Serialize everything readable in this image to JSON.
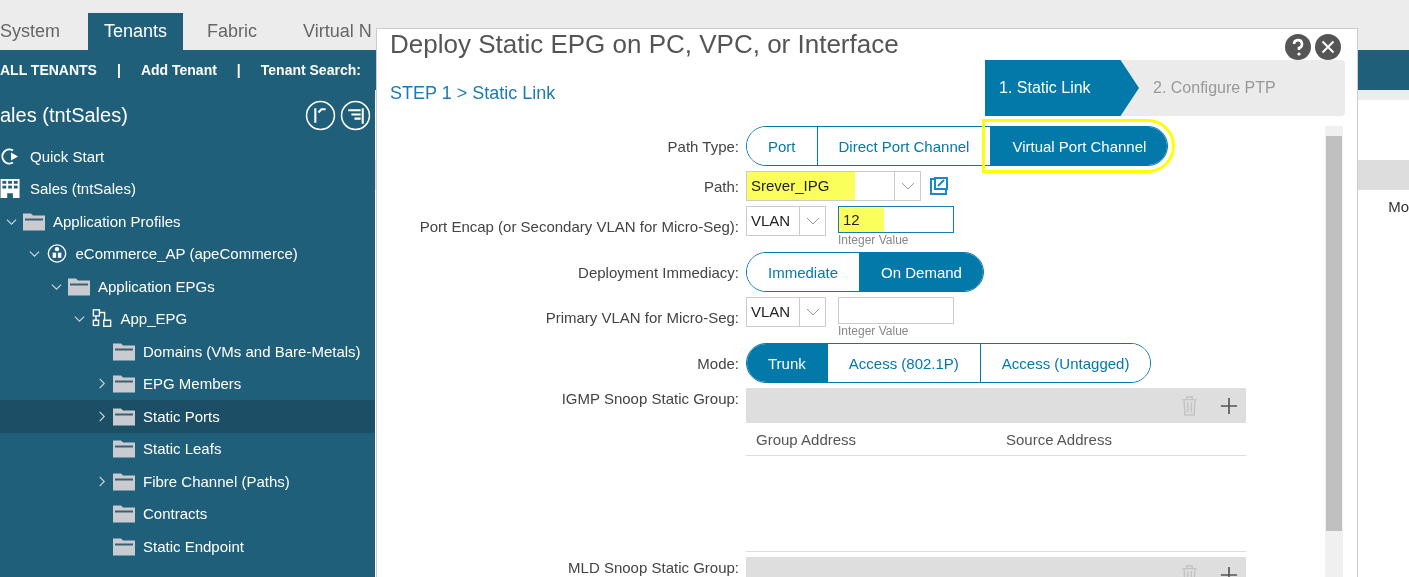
{
  "top_tabs": [
    {
      "label": "System",
      "selected": false
    },
    {
      "label": "Tenants",
      "selected": true
    },
    {
      "label": "Fabric",
      "selected": false
    },
    {
      "label": "Virtual N",
      "selected": false
    }
  ],
  "tenant_bar": {
    "links": [
      "ALL TENANTS",
      "Add Tenant"
    ],
    "separators": [
      "|",
      "|"
    ],
    "search_label": "Tenant Search:"
  },
  "sidebar": {
    "title": "ales (tntSales)",
    "items": [
      {
        "label": "Quick Start",
        "kind": "quickstart",
        "selected": false
      },
      {
        "label": "Sales (tntSales)",
        "kind": "tenant",
        "selected": false
      },
      {
        "label": "Application Profiles",
        "kind": "folder",
        "selected": false,
        "expanded": true,
        "children": [
          {
            "label": "eCommerce_AP (apeCommerce)",
            "kind": "profile",
            "selected": false,
            "expanded": true,
            "children": [
              {
                "label": "Application EPGs",
                "kind": "folder",
                "selected": false,
                "expanded": true,
                "children": [
                  {
                    "label": "App_EPG",
                    "kind": "epg",
                    "selected": false,
                    "expanded": true,
                    "children": [
                      {
                        "label": "Domains (VMs and Bare-Metals)",
                        "kind": "folder",
                        "selected": false
                      },
                      {
                        "label": "EPG Members",
                        "kind": "folder",
                        "selected": false,
                        "expanded": false
                      },
                      {
                        "label": "Static Ports",
                        "kind": "folder",
                        "selected": true,
                        "expanded": false
                      },
                      {
                        "label": "Static Leafs",
                        "kind": "folder",
                        "selected": false
                      },
                      {
                        "label": "Fibre Channel (Paths)",
                        "kind": "folder",
                        "selected": false,
                        "expanded": false
                      },
                      {
                        "label": "Contracts",
                        "kind": "folder",
                        "selected": false
                      },
                      {
                        "label": "Static Endpoint",
                        "kind": "folder",
                        "selected": false
                      }
                    ]
                  }
                ]
              }
            ]
          }
        ]
      }
    ]
  },
  "background_column_label": "Mo",
  "dialog": {
    "title": "Deploy Static EPG on PC, VPC, or Interface",
    "step": "STEP 1 > Static Link",
    "wizard": [
      {
        "label": "1. Static Link",
        "selected": true
      },
      {
        "label": "2. Configure PTP",
        "selected": false
      }
    ],
    "rows": [
      {
        "kind": "segmented",
        "label": "Path Type:",
        "options": [
          {
            "label": "Port",
            "selected": false,
            "highlighted": false
          },
          {
            "label": "Direct Port Channel",
            "selected": false,
            "highlighted": false
          },
          {
            "label": "Virtual Port Channel",
            "selected": true,
            "highlighted": true
          }
        ]
      },
      {
        "kind": "select",
        "label": "Path:",
        "value": "Srever_IPG",
        "highlighted": true
      },
      {
        "kind": "select-input",
        "label": "Port Encap (or Secondary VLAN for Micro-Seg):",
        "select_value": "VLAN",
        "value": "12",
        "hint": "Integer Value",
        "focused": true,
        "highlighted": true
      },
      {
        "kind": "segmented",
        "label": "Deployment Immediacy:",
        "options": [
          {
            "label": "Immediate",
            "selected": false,
            "highlighted": false
          },
          {
            "label": "On Demand",
            "selected": true,
            "highlighted": false
          }
        ]
      },
      {
        "kind": "select-input",
        "label": "Primary VLAN for Micro-Seg:",
        "select_value": "VLAN",
        "hint": "Integer Value",
        "focused": false,
        "highlighted": false
      },
      {
        "kind": "segmented",
        "label": "Mode:",
        "options": [
          {
            "label": "Trunk",
            "selected": true,
            "highlighted": false
          },
          {
            "label": "Access (802.1P)",
            "selected": false,
            "highlighted": false
          },
          {
            "label": "Access (Untagged)",
            "selected": false,
            "highlighted": false
          }
        ]
      },
      {
        "kind": "table",
        "label": "IGMP Snoop Static Group:",
        "columns": [
          "Group Address",
          "Source Address"
        ]
      },
      {
        "kind": "table",
        "label": "MLD Snoop Static Group:"
      }
    ]
  }
}
